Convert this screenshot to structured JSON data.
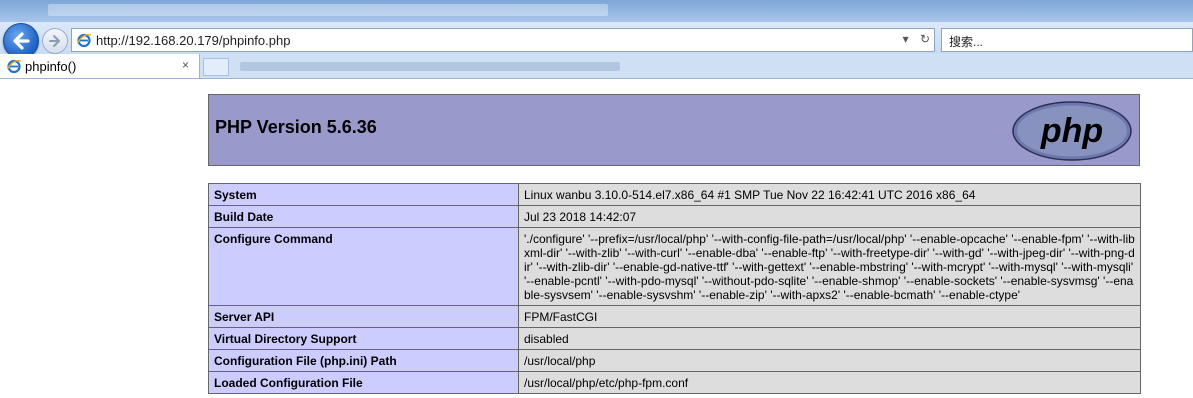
{
  "browser": {
    "address_url": "http://192.168.20.179/phpinfo.php",
    "search_placeholder": "搜索...",
    "tab_label": "phpinfo()",
    "tab_close": "×",
    "refresh_icon": "↻",
    "dropdown_icon": "▾"
  },
  "page": {
    "title": "PHP Version 5.6.36",
    "logo_text": "php",
    "colors": {
      "header_bg": "#9999cc",
      "key_bg": "#ccccff",
      "value_bg": "#dddddd"
    }
  },
  "info_table": [
    {
      "key": "System",
      "value": "Linux wanbu 3.10.0-514.el7.x86_64 #1 SMP Tue Nov 22 16:42:41 UTC 2016 x86_64"
    },
    {
      "key": "Build Date",
      "value": "Jul 23 2018 14:42:07"
    },
    {
      "key": "Configure Command",
      "value": "'./configure' '--prefix=/usr/local/php' '--with-config-file-path=/usr/local/php' '--enable-opcache' '--enable-fpm' '--with-libxml-dir' '--with-zlib' '--with-curl' '--enable-dba' '--enable-ftp' '--with-freetype-dir' '--with-gd' '--with-jpeg-dir' '--with-png-dir' '--with-zlib-dir' '--enable-gd-native-ttf' '--with-gettext' '--enable-mbstring' '--with-mcrypt' '--with-mysql' '--with-mysqli' '--enable-pcntl' '--with-pdo-mysql' '--without-pdo-sqlite' '--enable-shmop' '--enable-sockets' '--enable-sysvmsg' '--enable-sysvsem' '--enable-sysvshm' '--enable-zip' '--with-apxs2' '--enable-bcmath' '--enable-ctype'"
    },
    {
      "key": "Server API",
      "value": "FPM/FastCGI"
    },
    {
      "key": "Virtual Directory Support",
      "value": "disabled"
    },
    {
      "key": "Configuration File (php.ini) Path",
      "value": "/usr/local/php"
    },
    {
      "key": "Loaded Configuration File",
      "value": "/usr/local/php/etc/php-fpm.conf"
    }
  ]
}
